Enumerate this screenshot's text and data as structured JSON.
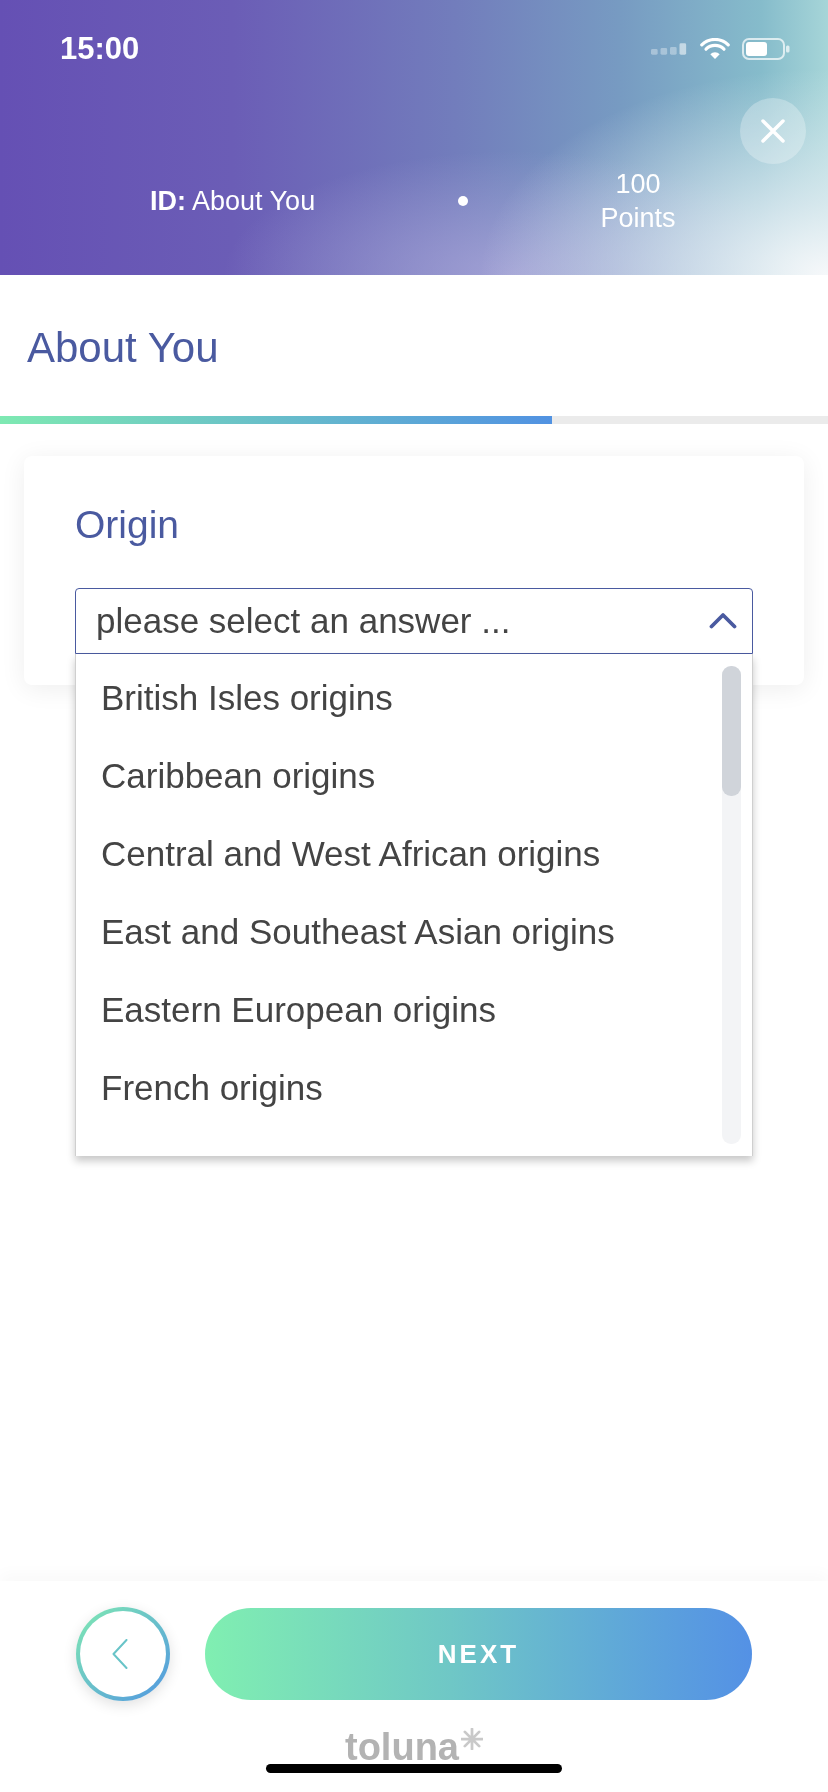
{
  "status_bar": {
    "time": "15:00"
  },
  "header": {
    "survey_id": "**ID:** About You",
    "points": "100 Points"
  },
  "page": {
    "title": "About You",
    "progress": {
      "level": 0.667
    }
  },
  "question": {
    "label": "Origin",
    "select": {
      "placeholder": "please select an answer ...",
      "expanded": true,
      "options": [
        {
          "label": "British Isles origins",
          "selected": false
        },
        {
          "label": "Caribbean origins",
          "selected": false
        },
        {
          "label": "Central and West African origins",
          "selected": false
        },
        {
          "label": "East and Southeast Asian origins",
          "selected": false
        },
        {
          "label": "Eastern European origins",
          "selected": false
        },
        {
          "label": "French origins",
          "selected": false
        }
      ]
    }
  },
  "footer": {
    "next_label": "NEXT",
    "brand": "toluna"
  }
}
